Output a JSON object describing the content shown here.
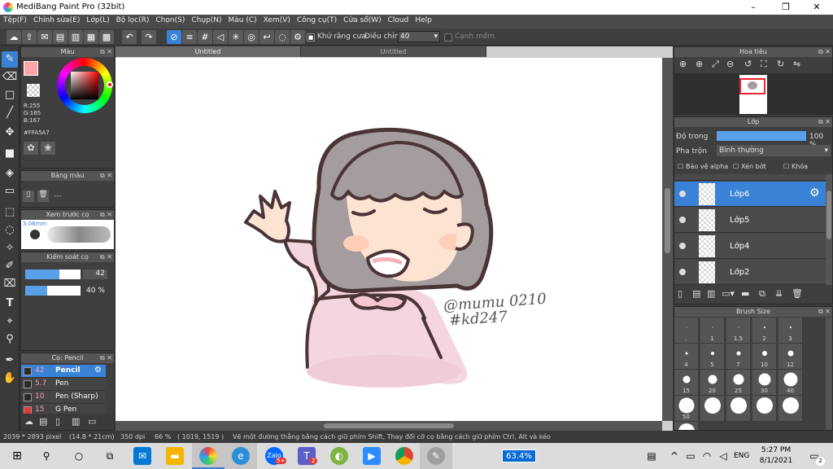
{
  "window": {
    "title": "MediBang Paint Pro (32bit)"
  },
  "menu": [
    "Tệp(F)",
    "Chỉnh sửa(E)",
    "Lớp(L)",
    "Bộ lọc(R)",
    "Chọn(S)",
    "Chụp(N)",
    "Màu (C)",
    "Xem(V)",
    "Công cụ(T)",
    "Cửa sổ(W)",
    "Cloud",
    "Help"
  ],
  "toolbar": {
    "antialias_label": "Khử răng cưa",
    "correction_label": "Điều chỉnh",
    "correction_value": "40",
    "edge_label": "Cạnh mềm"
  },
  "color_panel": {
    "title": "Màu",
    "r": "R:255",
    "g": "G:165",
    "b": "B:167",
    "hex": "#FFA5A7",
    "fg_color": "#FFA5A7"
  },
  "palette_panel": {
    "title": "Bảng màu",
    "value": "---"
  },
  "brush_preview": {
    "title": "Xem trước cọ",
    "size": "3.06mm"
  },
  "brush_control": {
    "title": "Kiểm soát cọ",
    "size_value": "42",
    "opacity_value": "40 %",
    "size_frac": 0.62,
    "opacity_frac": 0.4
  },
  "brush_list": {
    "title": "Cọ: Pencil",
    "items": [
      {
        "size": "42",
        "name": "Pencil",
        "color": "#2a2a2a",
        "selected": true
      },
      {
        "size": "5.7",
        "name": "Pen",
        "color": "#2a2a2a"
      },
      {
        "size": "10",
        "name": "Pen (Sharp)",
        "color": "#2a2a2a"
      },
      {
        "size": "15",
        "name": "G Pen",
        "color": "#e53935"
      }
    ]
  },
  "doc_tabs": [
    "Untitled",
    "Untitled"
  ],
  "canvas": {
    "signature_line1": "@mumu 0210",
    "signature_line2": "#kd247"
  },
  "navigator": {
    "title": "Hoa tiêu"
  },
  "layer_panel": {
    "title": "Lớp",
    "opacity_label": "Độ trong",
    "opacity_value": "100 %",
    "blend_label": "Pha trộn",
    "blend_value": "Bình thường",
    "protect_alpha": "Bảo vệ alpha",
    "clipping": "Xén bớt",
    "lock": "Khóa",
    "layers": [
      {
        "name": "Lớp6",
        "selected": true
      },
      {
        "name": "Lớp5"
      },
      {
        "name": "Lớp4"
      },
      {
        "name": "Lớp2"
      }
    ]
  },
  "brush_size_panel": {
    "title": "Brush Size",
    "sizes": [
      ".",
      "1",
      "1.5",
      "2",
      "3",
      "4",
      "5",
      "7",
      "10",
      "12",
      "15",
      "20",
      "25",
      "30",
      "40",
      "50",
      "",
      "",
      "",
      "",
      ""
    ]
  },
  "status": {
    "dimensions": "2039 * 2893 pixel",
    "physical": "(14.8 * 21cm)",
    "dpi": "350 dpi",
    "zoom": "66 %",
    "coords": "( 1019, 1519 )",
    "hint": "Vẽ một đường thẳng bằng cách giữ phím Shift, Thay đổi cỡ cọ bằng cách giữ phím Ctrl, Alt và kéo"
  },
  "taskbar": {
    "battery": "63.4%",
    "lang": "ENG",
    "time": "5:27 PM",
    "date": "8/1/2021",
    "notif_count": "2",
    "zalo_badge": "5+",
    "teams_badge": "2"
  }
}
